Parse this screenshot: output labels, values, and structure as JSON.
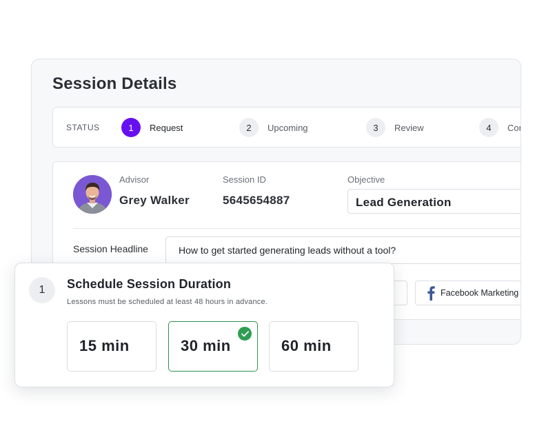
{
  "panel": {
    "title": "Session Details",
    "status_label": "STATUS",
    "steps": [
      {
        "num": "1",
        "label": "Request"
      },
      {
        "num": "2",
        "label": "Upcoming"
      },
      {
        "num": "3",
        "label": "Review"
      },
      {
        "num": "4",
        "label": "Con"
      }
    ],
    "advisor": {
      "label": "Advisor",
      "value": "Grey Walker"
    },
    "session": {
      "label": "Session ID",
      "value": "5645654887"
    },
    "objective": {
      "label": "Objective",
      "value": "Lead Generation"
    },
    "headline": {
      "label": "Session Headline",
      "value": "How to get started generating leads without a tool?"
    },
    "tags": {
      "facebook": "Facebook Marketing",
      "facebook_icon": "facebook-icon"
    }
  },
  "schedule": {
    "step_num": "1",
    "title": "Schedule Session Duration",
    "subtitle": "Lessons must be scheduled at least 48 hours in advance.",
    "options": [
      {
        "label": "15 min",
        "selected": false
      },
      {
        "label": "30 min",
        "selected": true
      },
      {
        "label": "60 min",
        "selected": false
      }
    ],
    "check_icon": "check-icon"
  },
  "colors": {
    "accent": "#6610f2",
    "selected": "#2e9e52",
    "facebook": "#3b5998"
  }
}
